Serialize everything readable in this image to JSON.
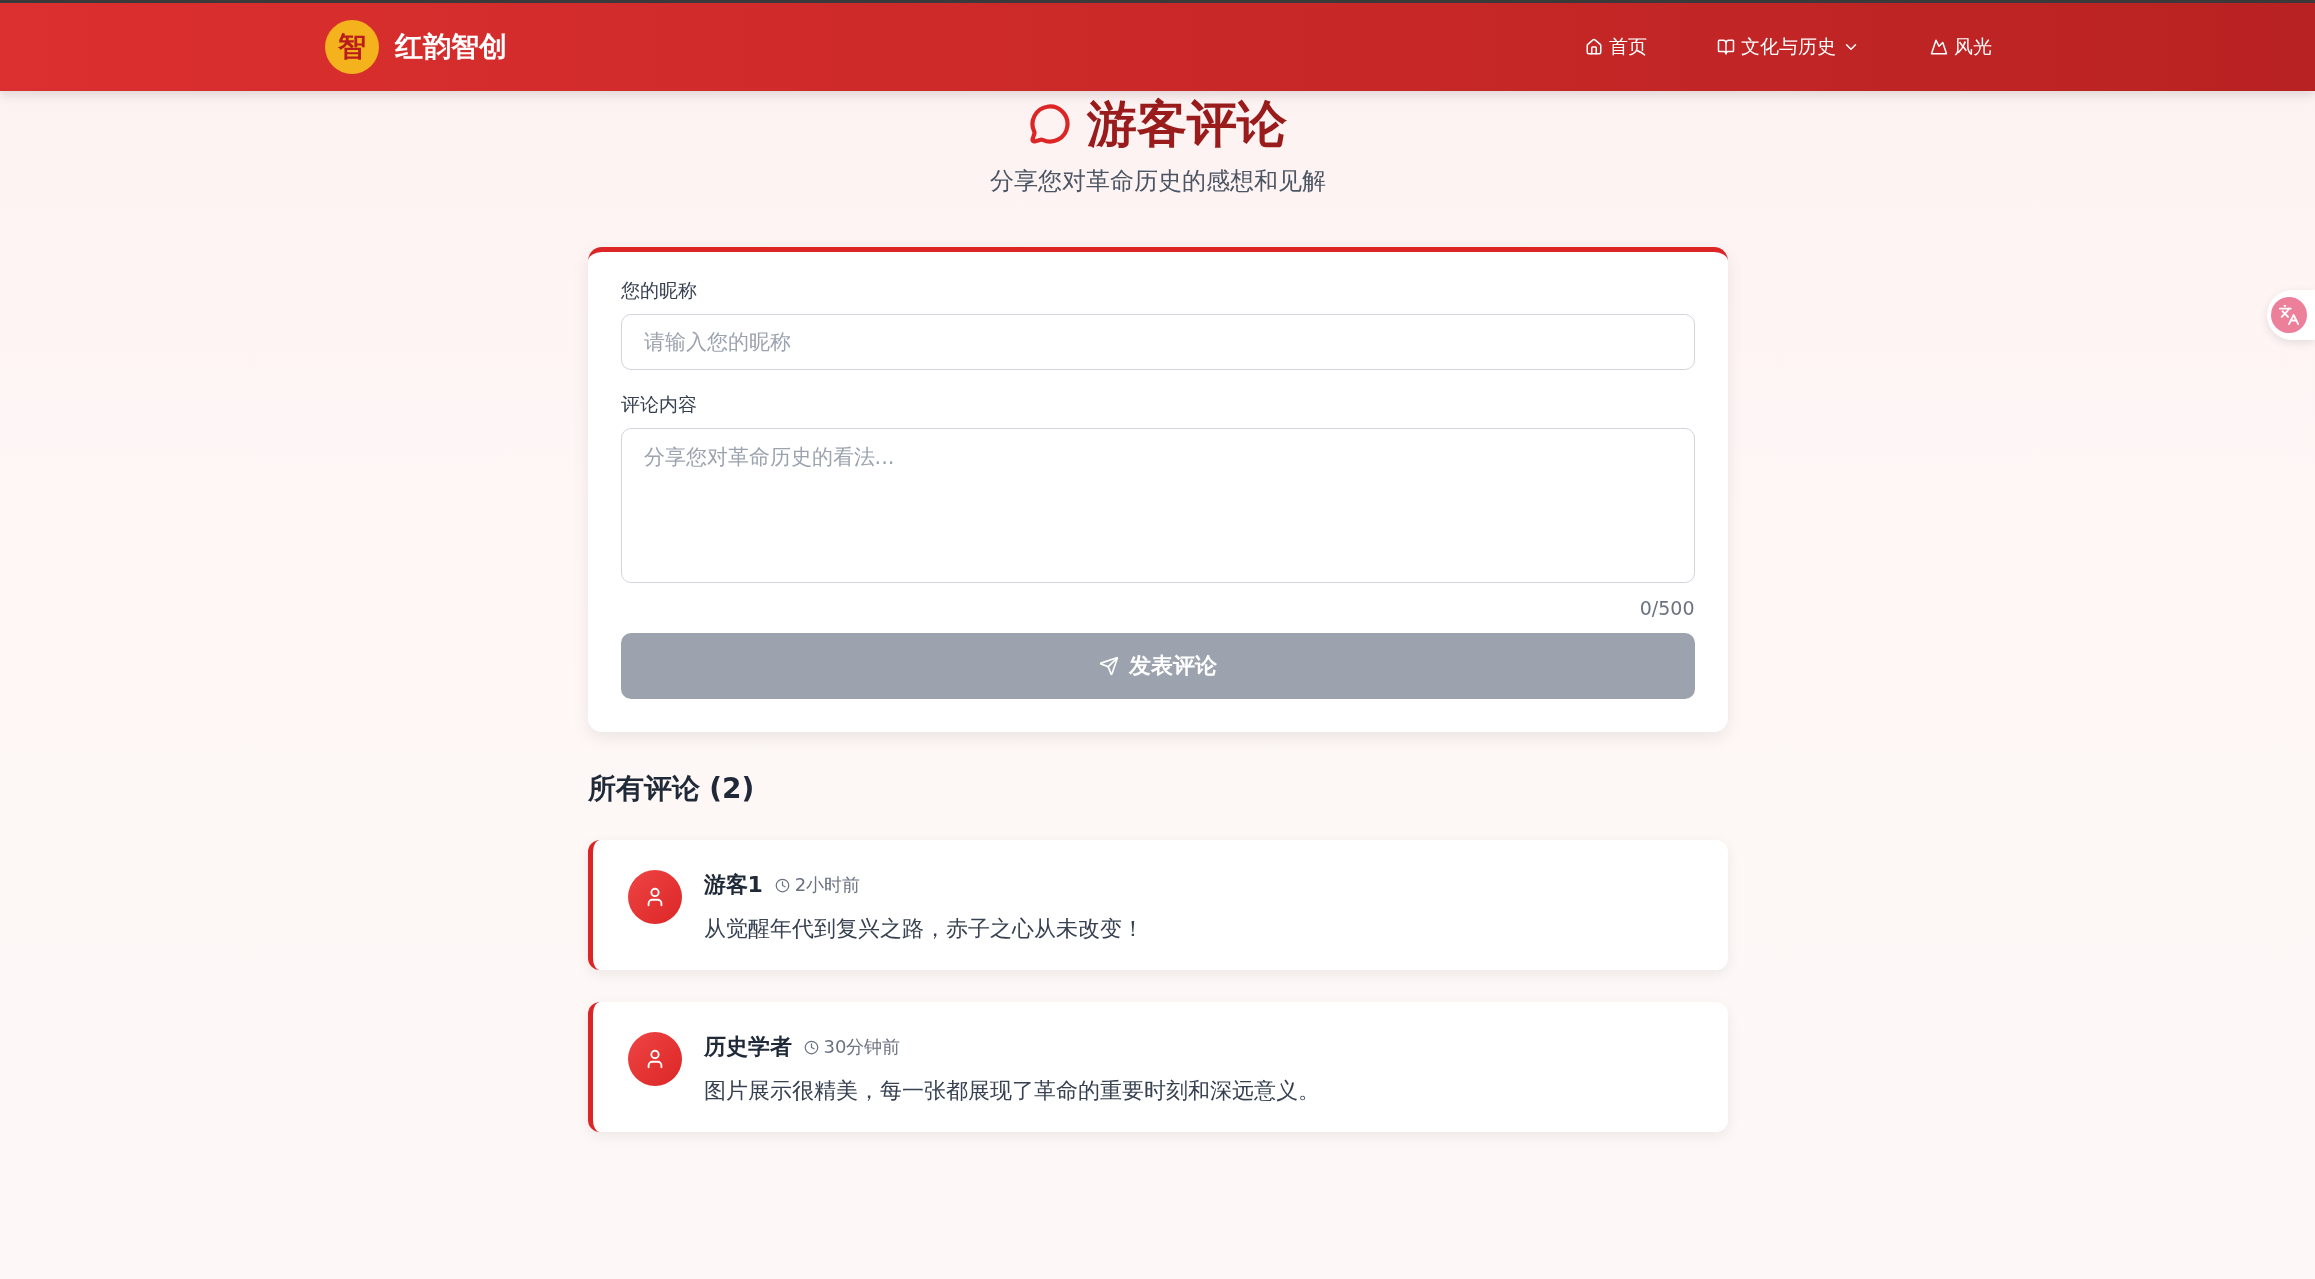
{
  "header": {
    "logo_mark": "智",
    "brand": "红韵智创",
    "nav": [
      {
        "label": "首页",
        "dropdown": false
      },
      {
        "label": "文化与历史",
        "dropdown": true
      },
      {
        "label": "风光",
        "dropdown": false
      }
    ]
  },
  "page": {
    "title": "游客评论",
    "subtitle": "分享您对革命历史的感想和见解"
  },
  "form": {
    "nickname_label": "您的昵称",
    "nickname_placeholder": "请输入您的昵称",
    "content_label": "评论内容",
    "content_placeholder": "分享您对革命历史的看法...",
    "counter": "0/500",
    "submit": {
      "label": "发表评论",
      "disabled": true
    }
  },
  "comments_heading": "所有评论 (2)",
  "comments": [
    {
      "author": "游客1",
      "time": "2小时前",
      "text": "从觉醒年代到复兴之路，赤子之心从未改变！"
    },
    {
      "author": "历史学者",
      "time": "30分钟前",
      "text": "图片展示很精美，每一张都展现了革命的重要时刻和深远意义。"
    }
  ]
}
